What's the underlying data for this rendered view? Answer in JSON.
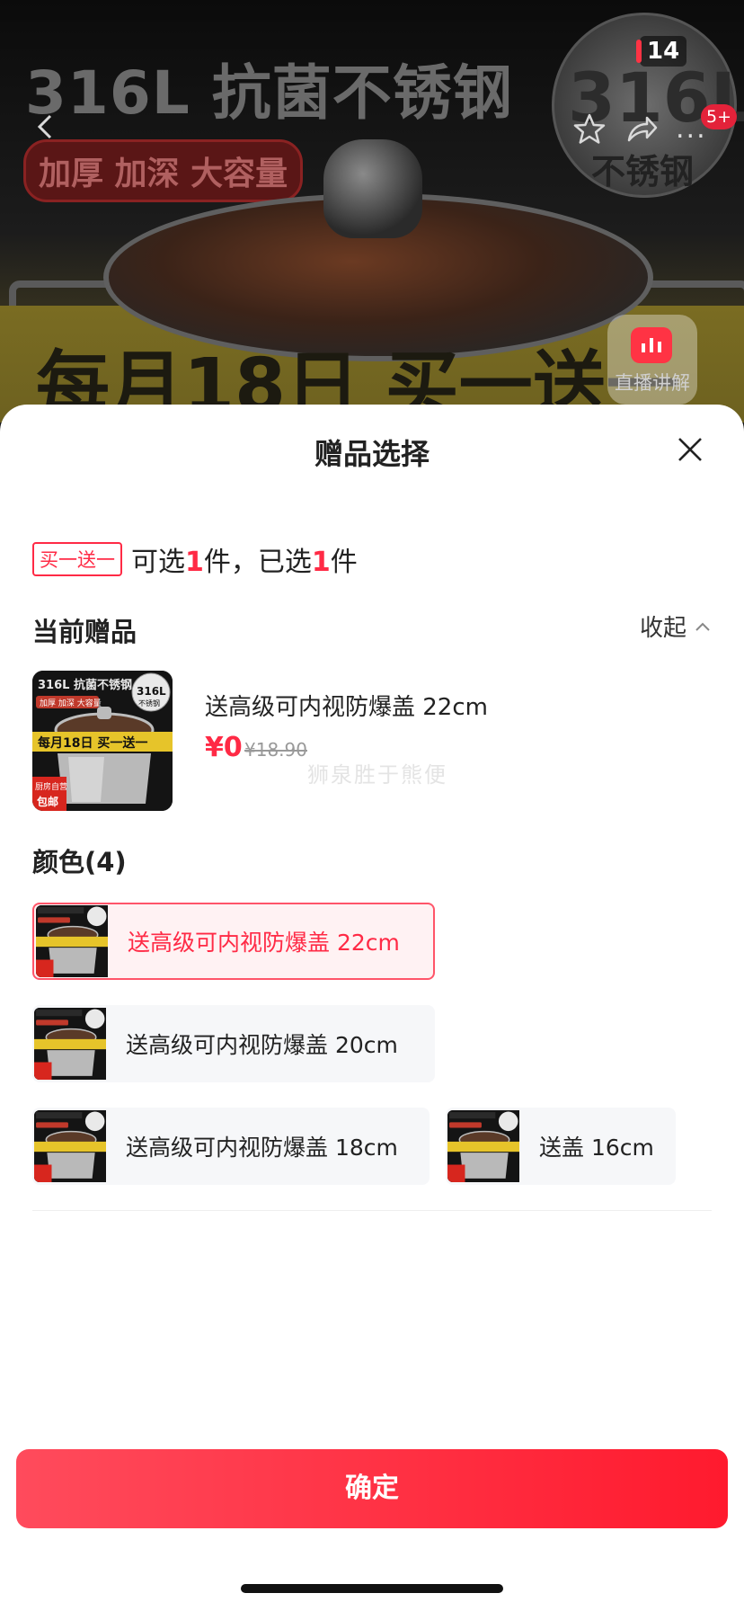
{
  "hero": {
    "title": "316L 抗菌不锈钢",
    "subtitle": "加厚 加深 大容量",
    "badge_main": "316L",
    "badge_sub": "不锈钢",
    "banner": "每月18日 买一送一",
    "status_count": "14",
    "cart_count": "5+",
    "more_label": "...",
    "live_label": "直播讲解"
  },
  "sheet": {
    "title": "赠品选择",
    "promo_tag": "买一送一",
    "summary_prefix": "可选",
    "summary_selectable": "1",
    "summary_middle": "件，已选",
    "summary_selected": "1",
    "summary_suffix": "件",
    "current_section": "当前赠品",
    "collapse_label": "收起",
    "current_gift": {
      "name": "送高级可内视防爆盖 22cm",
      "price": "¥0",
      "original_price": "¥18.90"
    },
    "watermark": "狮泉胜于熊便",
    "color_section": "颜色(4)",
    "options": [
      {
        "label": "送高级可内视防爆盖 22cm",
        "selected": true
      },
      {
        "label": "送高级可内视防爆盖 20cm",
        "selected": false
      },
      {
        "label": "送高级可内视防爆盖 18cm",
        "selected": false
      },
      {
        "label": "送盖 16cm",
        "selected": false
      }
    ],
    "confirm_label": "确定"
  },
  "thumbnail_text": {
    "title": "316L 抗菌不锈钢",
    "sub": "加厚 加深 大容量",
    "banner": "每月18日 买一送一",
    "badge": "316L",
    "badge_sub": "不锈钢",
    "corner_top": "厨房自营",
    "corner_bottom": "包邮"
  },
  "colors": {
    "accent": "#ff2a45",
    "selected_border": "#ff5569",
    "option_bg": "#f6f7f9"
  }
}
